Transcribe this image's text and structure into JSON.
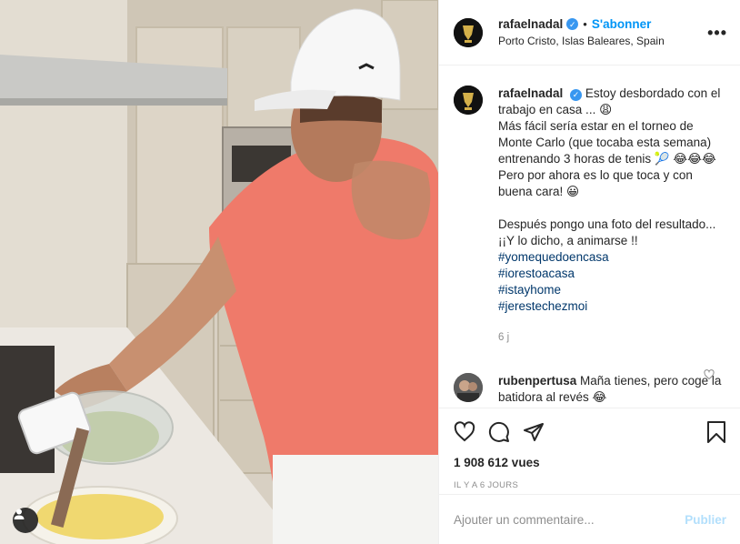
{
  "media": {
    "alt": "video-frame"
  },
  "header": {
    "username": "rafaelnadal",
    "verified_mark": "✓",
    "separator": "•",
    "follow_label": "S'abonner",
    "location": "Porto Cristo, Islas Baleares, Spain",
    "more_label": "•••"
  },
  "caption": {
    "username": "rafaelnadal",
    "text": "Estoy desbordado con el trabajo en casa ... 😩\nMás fácil sería estar en el torneo de Monte Carlo (que tocaba esta semana) entrenando 3 horas de tenis 🎾 😂😂😂 Pero por ahora es lo que toca y con buena cara! 😀\n\nDespués pongo una foto del resultado... ¡¡Y lo dicho, a animarse !!",
    "hashtags": [
      "#yomequedoencasa",
      "#iorestoacasa",
      "#istayhome",
      "#jerestechezmoi"
    ],
    "age": "6 j"
  },
  "reply": {
    "username": "rubenpertusa",
    "text": "Maña tienes, pero coge la batidora al revés 😂"
  },
  "stats": {
    "views": "1 908 612 vues",
    "posted": "IL Y A 6 JOURS"
  },
  "comment_input": {
    "placeholder": "Ajouter un commentaire...",
    "publish_label": "Publier"
  },
  "colors": {
    "accent": "#0095f6",
    "verified": "#3897f0",
    "muted": "#8e8e8e",
    "shirt": "#ef7a6a",
    "cap": "#f7f7f7"
  }
}
